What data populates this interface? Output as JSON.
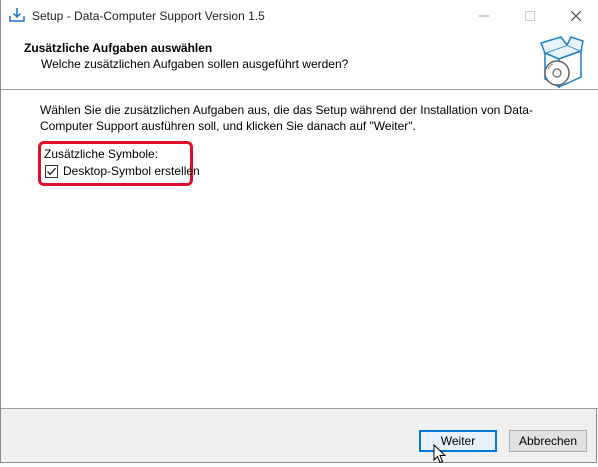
{
  "window": {
    "title": "Setup - Data-Computer Support Version 1.5"
  },
  "header": {
    "title": "Zusätzliche Aufgaben auswählen",
    "subtitle": "Welche zusätzlichen Aufgaben sollen ausgeführt werden?"
  },
  "body": {
    "description": "Wählen Sie die zusätzlichen Aufgaben aus, die das Setup während der Installation von Data-Computer Support ausführen soll, und klicken Sie danach auf \"Weiter\".",
    "group_label": "Zusätzliche Symbole:",
    "tasks": [
      {
        "label": "Desktop-Symbol erstellen",
        "checked": true
      }
    ]
  },
  "buttons": {
    "next": "Weiter",
    "cancel": "Abbrechen"
  },
  "colors": {
    "highlight": "#e0102a",
    "default_button_border": "#0078d7"
  },
  "icons": [
    "installer-app-icon",
    "minimize-icon",
    "maximize-icon",
    "close-icon",
    "setup-box-disc-icon",
    "checkmark-icon",
    "mouse-cursor-icon"
  ]
}
